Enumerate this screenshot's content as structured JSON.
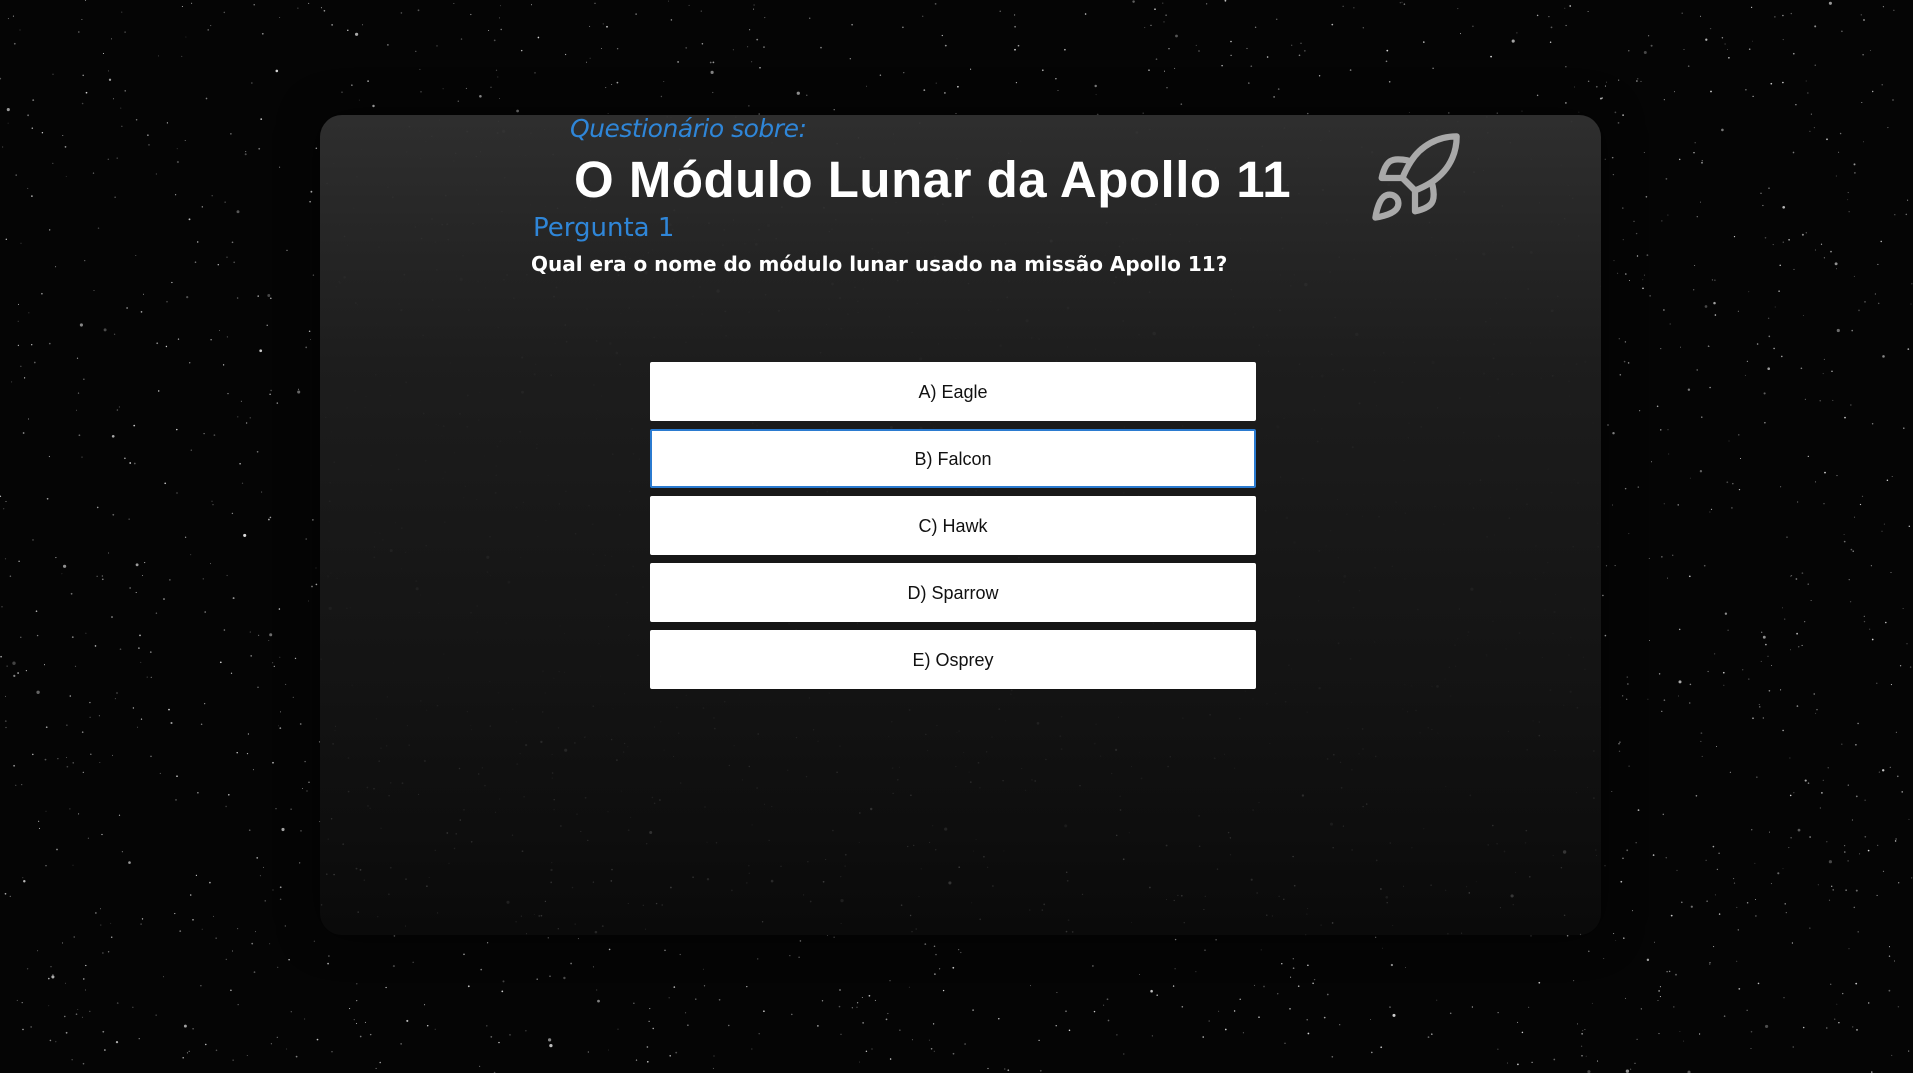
{
  "quiz": {
    "subtitle": "Questionário sobre:",
    "title": "O Módulo Lunar da Apollo 11",
    "icon": "rocket-icon"
  },
  "question": {
    "number_label": "Pergunta 1",
    "text": "Qual era o nome do módulo lunar usado na missão Apollo 11?",
    "options": [
      {
        "label": "A) Eagle"
      },
      {
        "label": "B) Falcon"
      },
      {
        "label": "C) Hawk"
      },
      {
        "label": "D) Sparrow"
      },
      {
        "label": "E) Osprey"
      }
    ],
    "focused_option": "B) Falcon"
  },
  "colors": {
    "accent": "#2f86d8",
    "background": "#050505",
    "panel": "#262626",
    "option_bg": "#ffffff"
  }
}
